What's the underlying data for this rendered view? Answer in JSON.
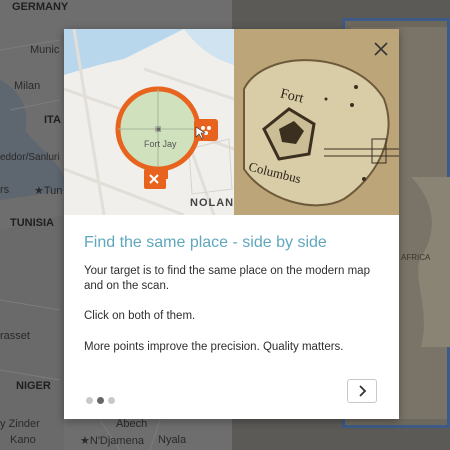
{
  "background_labels": {
    "germany": "GERMANY",
    "munich": "Munic",
    "milan": "Milan",
    "italy": "ITA",
    "cagliari": "eddor/Sanluri",
    "tunis": "Tun",
    "tunisia": "TUNISIA",
    "rs": "rs",
    "trasset": "rasset",
    "niger": "NIGER",
    "zinder": "y Zinder",
    "kano": "Kano",
    "ndjamena": "N'Djamena",
    "nyala": "Nyala",
    "abeche": "Abech",
    "africa": "AFRICA"
  },
  "modal": {
    "hero": {
      "circle_label": "Fort Jay",
      "map_label": "NOLAN",
      "scan_label_1": "Fort",
      "scan_label_2": "Columbus"
    },
    "title": "Find the same place - side by side",
    "paragraphs": [
      "Your target is to find the same place on the modern map and on the scan.",
      "Click on both of them.",
      "More points improve the precision. Quality matters."
    ],
    "pagination": {
      "total": 3,
      "current": 2
    }
  },
  "colors": {
    "accent": "#5fa7bd",
    "marker": "#e8641e",
    "modal_bg": "#ffffff"
  }
}
